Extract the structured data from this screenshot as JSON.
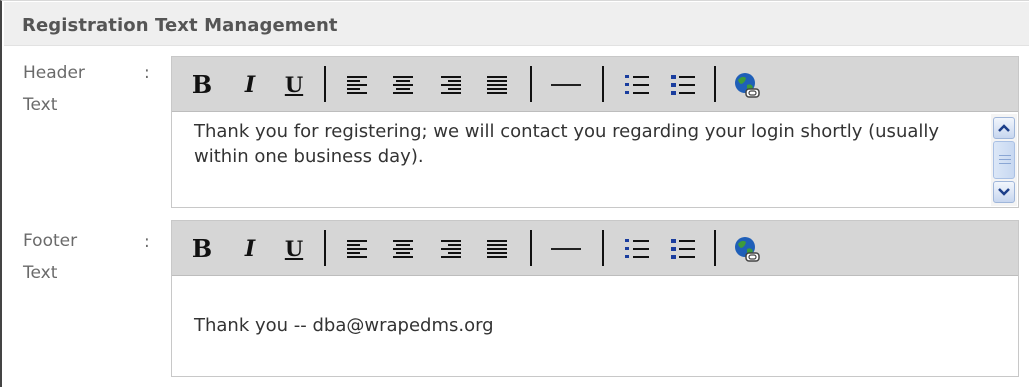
{
  "panel": {
    "title": "Registration Text Management"
  },
  "header_field": {
    "label_line1": "Header",
    "label_line2": "Text",
    "colon": ":",
    "content": "Thank you for registering; we will contact you regarding your login shortly (usually within one business day)."
  },
  "footer_field": {
    "label_line1": "Footer",
    "label_line2": "Text",
    "colon": ":",
    "content": "Thank you -- dba@wrapedms.org"
  },
  "toolbar": {
    "bold": "B",
    "italic": "I",
    "underline": "U",
    "icons": [
      "align-left-icon",
      "align-center-icon",
      "align-right-icon",
      "align-justify-icon",
      "horizontal-rule-icon",
      "ordered-list-icon",
      "unordered-list-icon",
      "insert-link-globe-icon"
    ]
  },
  "colors": {
    "title_bar": "#efefef",
    "toolbar": "#d6d6d6",
    "list_accent": "#1a3d9e"
  }
}
